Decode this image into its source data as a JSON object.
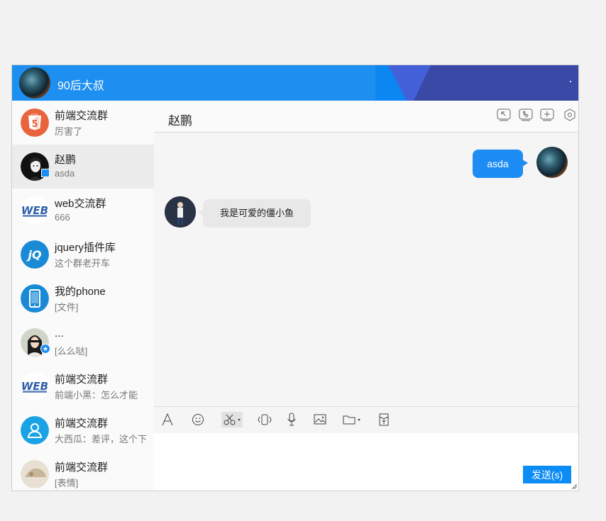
{
  "user": {
    "name": "90后大叔"
  },
  "conversations": [
    {
      "name": "前端交流群",
      "last_message": "厉害了",
      "avatar": "html5-logo"
    },
    {
      "name": "赵鹏",
      "last_message": "asda",
      "avatar": "person-photo"
    },
    {
      "name": "web交流群",
      "last_message": "666",
      "avatar": "web-logo"
    },
    {
      "name": "jquery插件库",
      "last_message": "这个群老开车",
      "avatar": "jquery-logo"
    },
    {
      "name": "我的phone",
      "last_message": "[文件]",
      "avatar": "phone-icon"
    },
    {
      "name": "...",
      "last_message": "[么么哒]",
      "avatar": "person-photo"
    },
    {
      "name": "前端交流群",
      "last_message": "前端小黑：怎么才能",
      "avatar": "web-logo"
    },
    {
      "name": "前端交流群",
      "last_message": "大西瓜：差评，这个下",
      "avatar": "user-group-icon"
    },
    {
      "name": "前端交流群",
      "last_message": "[表情]",
      "avatar": "person-photo"
    }
  ],
  "chat": {
    "title": "赵鹏",
    "messages": [
      {
        "direction": "out",
        "text": "asda"
      },
      {
        "direction": "in",
        "text": "我是可爱的僵小鱼"
      }
    ],
    "send_label": "发送(s)"
  },
  "toolbar_icons": [
    "font-icon",
    "emoji-icon",
    "screenshot-icon",
    "shake-icon",
    "voice-icon",
    "image-icon",
    "folder-icon",
    "red-packet-icon"
  ],
  "header_icons": [
    "shrink-icon",
    "phone-icon",
    "add-icon",
    "settings-icon"
  ],
  "colors": {
    "accent": "#1c8ff0",
    "send": "#0c8cf5",
    "bubble_out": "#1d8cf5",
    "bubble_in": "#e8e8e8"
  }
}
